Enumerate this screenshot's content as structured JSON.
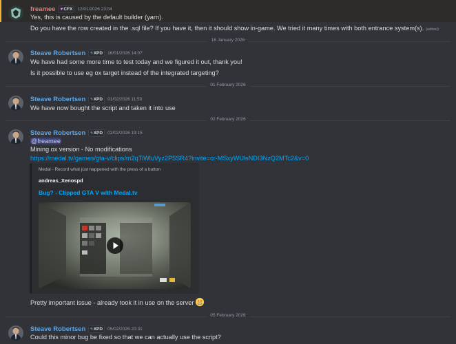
{
  "colors": {
    "reply_highlight": "#f0b232",
    "author1": "#e67e80",
    "author2": "#5fa7e8",
    "link": "#00a8fc",
    "mention": "#c9cdfb"
  },
  "messages": [
    {
      "author": "freamee",
      "tag_icon": "heart-icon",
      "tag": "CFX",
      "timestamp": "12/01/2026 23:04",
      "lines": [
        "Yes, this is caused by the default builder (yarn).",
        "Do you have the row created in the .sql file? If you have it, then it should show in-game. We tried it many times with both entrance system(s)."
      ],
      "edited": "(edited)"
    },
    {
      "date_divider": "16 January 2026",
      "author": "Steave Robertsen",
      "tag_icon": "lightning-icon",
      "tag": "XPD",
      "timestamp": "16/01/2026 14:07",
      "lines": [
        "We have had some more time to test today and we figured it out, thank you!",
        "Is it possible to use eg ox target instead of the integrated targeting?"
      ]
    },
    {
      "date_divider": "01 February 2026",
      "author": "Steave Robertsen",
      "tag_icon": "lightning-icon",
      "tag": "XPD",
      "timestamp": "01/02/2026 11:50",
      "lines": [
        "We have now bought the script and taken it into use"
      ]
    },
    {
      "date_divider": "02 February 2026",
      "author": "Steave Robertsen",
      "tag_icon": "lightning-icon",
      "tag": "XPD",
      "timestamp": "02/02/2026 19:15",
      "mention": "@freamee",
      "lines": [
        "Mining ox version - No modifications"
      ],
      "link": "https://medal.tv/games/gta-v/clips/m2qTiWluVyz2P5SR4?invite=cr-MSxyWUlsNDI3NzQ2MTc2&v=0",
      "embed": {
        "provider": "Medal - Record what just happened with the press of a button",
        "author": "andreas_Xenospd",
        "title": "Bug? - Clipped GTA V with Medal.tv",
        "play_icon": "play-icon"
      },
      "after_text": "Pretty important issue - already took it in use on the server",
      "after_emoji": "grimace-emoji"
    },
    {
      "date_divider": "05 February 2026",
      "author": "Steave Robertsen",
      "tag_icon": "lightning-icon",
      "tag": "XPD",
      "timestamp": "05/02/2026 20:31",
      "lines": [
        "Could this minor bug be fixed so that we can actually use the script?"
      ]
    }
  ]
}
